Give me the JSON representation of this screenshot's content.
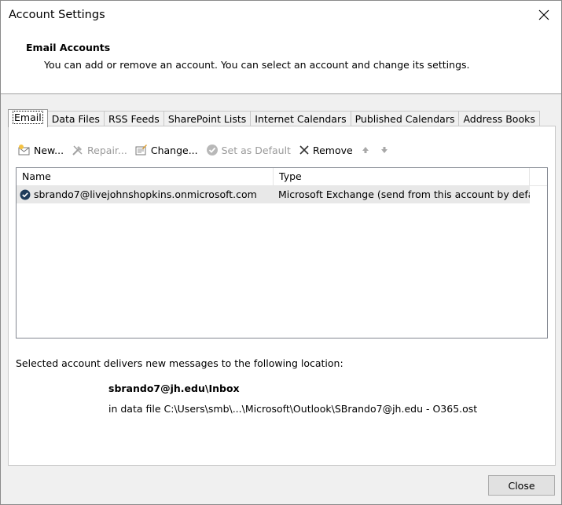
{
  "window": {
    "title": "Account Settings"
  },
  "header": {
    "section_title": "Email Accounts",
    "description": "You can add or remove an account. You can select an account and change its settings."
  },
  "tabs": [
    {
      "label": "Email",
      "active": true
    },
    {
      "label": "Data Files"
    },
    {
      "label": "RSS Feeds"
    },
    {
      "label": "SharePoint Lists"
    },
    {
      "label": "Internet Calendars"
    },
    {
      "label": "Published Calendars"
    },
    {
      "label": "Address Books"
    }
  ],
  "toolbar": {
    "new_label": "New...",
    "repair_label": "Repair...",
    "change_label": "Change...",
    "set_default_label": "Set as Default",
    "remove_label": "Remove"
  },
  "accounts": {
    "columns": [
      "Name",
      "Type"
    ],
    "rows": [
      {
        "name": "sbrando7@livejohnshopkins.onmicrosoft.com",
        "type": "Microsoft Exchange (send from this account by defa..."
      }
    ]
  },
  "delivery": {
    "label": "Selected account delivers new messages to the following location:",
    "location": "sbrando7@jh.edu\\Inbox",
    "data_file": "in data file C:\\Users\\smb\\...\\Microsoft\\Outlook\\SBrando7@jh.edu - O365.ost"
  },
  "footer": {
    "close_label": "Close"
  }
}
